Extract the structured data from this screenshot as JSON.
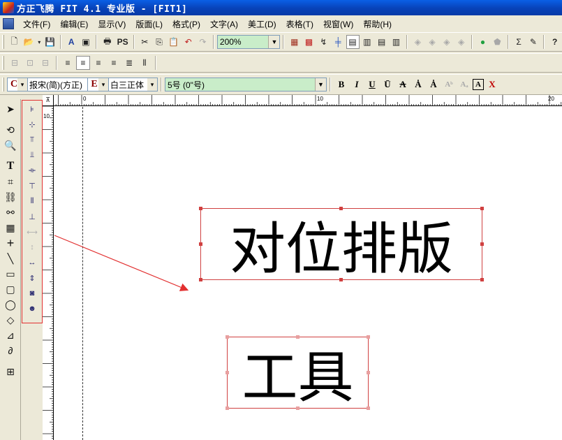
{
  "window": {
    "title": "方正飞腾 FIT 4.1 专业版 - [FIT1]"
  },
  "menu": [
    {
      "label": "文件(F)"
    },
    {
      "label": "编辑(E)"
    },
    {
      "label": "显示(V)"
    },
    {
      "label": "版面(L)"
    },
    {
      "label": "格式(P)"
    },
    {
      "label": "文字(A)"
    },
    {
      "label": "美工(D)"
    },
    {
      "label": "表格(T)"
    },
    {
      "label": "视窗(W)"
    },
    {
      "label": "帮助(H)"
    }
  ],
  "toolbar": {
    "zoom": "200%",
    "ps_label": "PS"
  },
  "format_bar": {
    "chinese_font_flag": "C",
    "chinese_font": "报宋(简)(方正)",
    "english_font_flag": "E",
    "english_font": "白三正体",
    "font_size": "5号 (0\"号)",
    "bold": "B",
    "italic": "I",
    "underline": "U",
    "overline": "Ū",
    "strike": "A",
    "emphasis": "Ȧ",
    "super": "Aᵇ",
    "sub": "Aₐ",
    "box": "A",
    "clear": "X"
  },
  "rulers": {
    "h_labels": [
      "0",
      "10",
      "20"
    ],
    "v_labels": [
      "10"
    ],
    "corner": "⊼"
  },
  "canvas": {
    "text1": "对位排版",
    "text2": "工具"
  },
  "colors": {
    "accent_red": "#e23030",
    "zoom_bg": "#c9edc9",
    "title_blue": "#0842b8"
  }
}
